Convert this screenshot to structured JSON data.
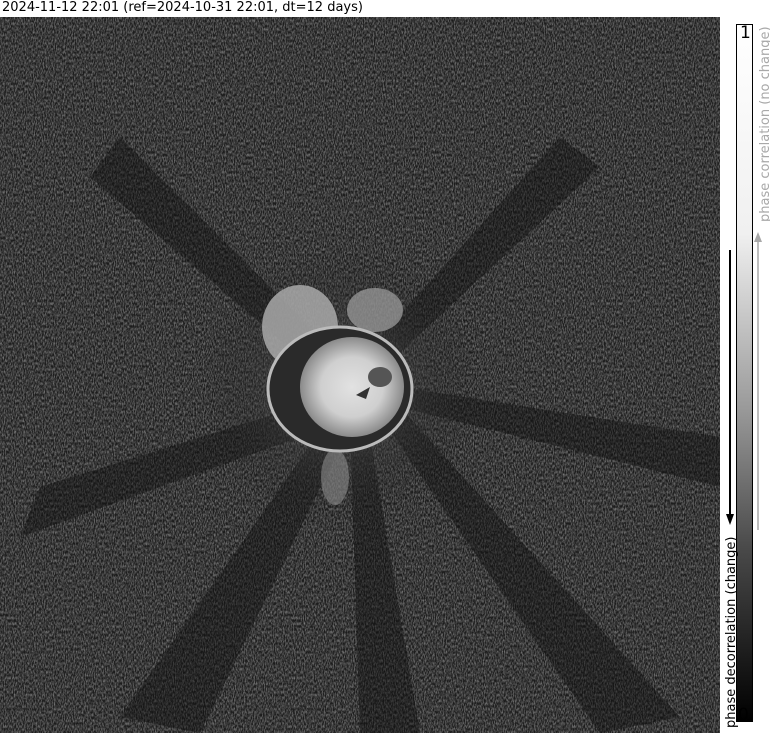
{
  "header": {
    "title": "2024-11-12 22:01 (ref=2024-10-31 22:01, dt=12 days)"
  },
  "image": {
    "subject": "coherence map of volcanic crater",
    "icon": "coherence-image"
  },
  "colorbar": {
    "top_value": "1",
    "bottom_value": "0",
    "top_label": "phase correlation (no change)",
    "bottom_label": "phase decorrelation (change)",
    "top_label_color": "#a8a8a8",
    "bottom_label_color": "#000000",
    "gradient_colors": [
      "#ffffff",
      "#000000"
    ]
  }
}
